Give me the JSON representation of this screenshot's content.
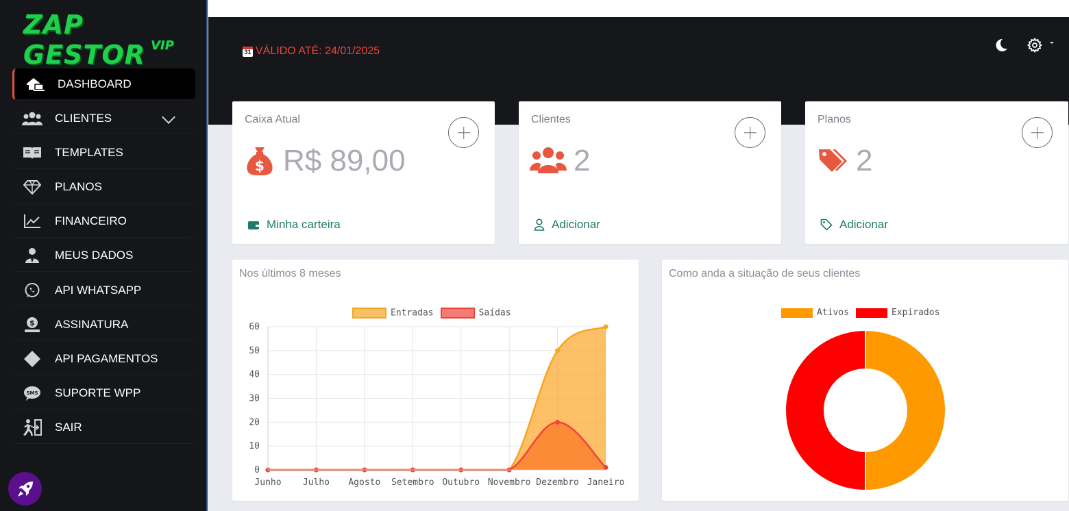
{
  "brand": {
    "name": "ZAP GESTOR",
    "tier": "VIP"
  },
  "sidebar": {
    "items": [
      {
        "label": "DASHBOARD",
        "icon": "house-laptop-icon",
        "active": true
      },
      {
        "label": "CLIENTES",
        "icon": "users-icon",
        "expandable": true
      },
      {
        "label": "TEMPLATES",
        "icon": "book-open-icon"
      },
      {
        "label": "PLANOS",
        "icon": "gem-icon"
      },
      {
        "label": "FINANCEIRO",
        "icon": "chart-line-icon"
      },
      {
        "label": "MEUS DADOS",
        "icon": "user-tie-icon"
      },
      {
        "label": "API WHATSAPP",
        "icon": "whatsapp-icon"
      },
      {
        "label": "ASSINATURA",
        "icon": "money-hand-icon"
      },
      {
        "label": "API PAGAMENTOS",
        "icon": "diamonds-icon"
      },
      {
        "label": "SUPORTE WPP",
        "icon": "sms-icon"
      },
      {
        "label": "SAIR",
        "icon": "exit-run-icon"
      }
    ]
  },
  "header": {
    "validity": "VÁLIDO ATÉ: 24/01/2025",
    "calendar_day": "31",
    "accent_red": "#f0443a"
  },
  "stats": [
    {
      "title": "Caixa Atual",
      "value": "R$ 89,00",
      "link": "Minha carteira",
      "icon": "money-bag-icon",
      "link_icon": "wallet-icon"
    },
    {
      "title": "Clientes",
      "value": "2",
      "link": "Adicionar",
      "icon": "users-icon",
      "link_icon": "user-icon"
    },
    {
      "title": "Planos",
      "value": "2",
      "link": "Adicionar",
      "icon": "tags-icon",
      "link_icon": "tag-icon"
    }
  ],
  "colors": {
    "accent": "#e8573f",
    "link": "#1f7a6a",
    "sidebar_bg": "#14161a"
  },
  "chart_data": [
    {
      "type": "area",
      "title": "Nos últimos 8 meses",
      "categories": [
        "Junho",
        "Julho",
        "Agosto",
        "Setembro",
        "Outubro",
        "Novembro",
        "Dezembro",
        "Janeiro"
      ],
      "series": [
        {
          "name": "Entradas",
          "values": [
            0,
            0,
            0,
            0,
            0,
            0,
            50,
            60
          ],
          "color": "#f6a623"
        },
        {
          "name": "Saídas",
          "values": [
            0,
            0,
            0,
            0,
            0,
            0,
            20,
            1
          ],
          "color": "#f0443a"
        }
      ],
      "ylim": [
        0,
        60
      ],
      "yticks": [
        0,
        10,
        20,
        30,
        40,
        50,
        60
      ],
      "grid": true,
      "legend": "top"
    },
    {
      "type": "pie",
      "title": "Como anda a situação de seus clientes",
      "categories": [
        "Ativos",
        "Expirados"
      ],
      "values": [
        1,
        1
      ],
      "colors": [
        "#ff9900",
        "#ff0000"
      ],
      "donut": true,
      "legend": "top"
    }
  ]
}
